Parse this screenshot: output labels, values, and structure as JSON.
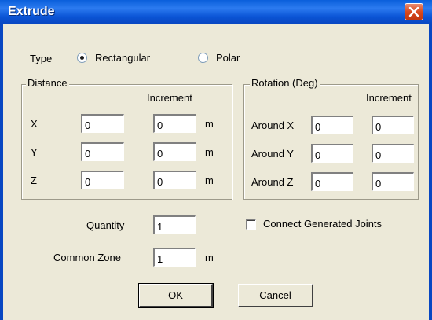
{
  "window": {
    "title": "Extrude",
    "close_icon": "close-icon"
  },
  "type": {
    "label": "Type",
    "options": [
      {
        "label": "Rectangular",
        "selected": true
      },
      {
        "label": "Polar",
        "selected": false
      }
    ]
  },
  "distance": {
    "legend": "Distance",
    "increment_header": "Increment",
    "rows": [
      {
        "label": "X",
        "value": "0",
        "increment": "0",
        "unit": "m"
      },
      {
        "label": "Y",
        "value": "0",
        "increment": "0",
        "unit": "m"
      },
      {
        "label": "Z",
        "value": "0",
        "increment": "0",
        "unit": "m"
      }
    ]
  },
  "rotation": {
    "legend": "Rotation (Deg)",
    "increment_header": "Increment",
    "rows": [
      {
        "label": "Around X",
        "value": "0",
        "increment": "0"
      },
      {
        "label": "Around Y",
        "value": "0",
        "increment": "0"
      },
      {
        "label": "Around Z",
        "value": "0",
        "increment": "0"
      }
    ]
  },
  "quantity": {
    "label": "Quantity",
    "value": "1"
  },
  "common_zone": {
    "label": "Common Zone",
    "value": "1",
    "unit": "m"
  },
  "connect_joints": {
    "label": "Connect Generated Joints",
    "checked": false
  },
  "buttons": {
    "ok": "OK",
    "cancel": "Cancel"
  }
}
